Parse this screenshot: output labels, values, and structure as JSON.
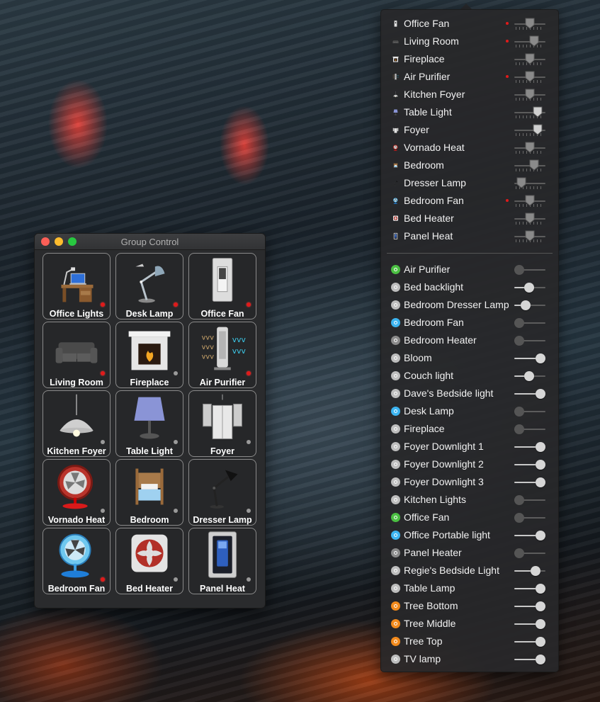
{
  "group_control": {
    "title": "Group Control",
    "tiles": [
      {
        "label": "Office Lights",
        "icon": "desk-icon",
        "led": "on"
      },
      {
        "label": "Desk Lamp",
        "icon": "desk-lamp-icon",
        "led": "on"
      },
      {
        "label": "Office Fan",
        "icon": "light-switch-icon",
        "led": "on"
      },
      {
        "label": "Living Room",
        "icon": "sofa-icon",
        "led": "on"
      },
      {
        "label": "Fireplace",
        "icon": "fireplace-icon",
        "led": "off"
      },
      {
        "label": "Air Purifier",
        "icon": "air-purifier-icon",
        "led": "on"
      },
      {
        "label": "Kitchen Foyer",
        "icon": "pendant-lamp-icon",
        "led": "off"
      },
      {
        "label": "Table Light",
        "icon": "table-lamp-icon",
        "led": "off"
      },
      {
        "label": "Foyer",
        "icon": "doorway-icon",
        "led": "off"
      },
      {
        "label": "Vornado Heat",
        "icon": "red-fan-icon",
        "led": "off"
      },
      {
        "label": "Bedroom",
        "icon": "bed-icon",
        "led": "off"
      },
      {
        "label": "Dresser Lamp",
        "icon": "arc-lamp-icon",
        "led": "off"
      },
      {
        "label": "Bedroom Fan",
        "icon": "blue-fan-icon",
        "led": "on"
      },
      {
        "label": "Bed Heater",
        "icon": "heater-icon",
        "led": "off"
      },
      {
        "label": "Panel Heat",
        "icon": "panel-switch-icon",
        "led": "off"
      }
    ]
  },
  "menu": {
    "group_rows": [
      {
        "label": "Office Fan",
        "icon": "light-switch-icon",
        "active": true,
        "level": 0.5
      },
      {
        "label": "Living Room",
        "icon": "sofa-icon",
        "active": true,
        "level": 0.7
      },
      {
        "label": "Fireplace",
        "icon": "fireplace-icon",
        "active": false,
        "level": 0.5
      },
      {
        "label": "Air Purifier",
        "icon": "air-purifier-icon",
        "active": true,
        "level": 0.5
      },
      {
        "label": "Kitchen Foyer",
        "icon": "pendant-lamp-icon",
        "active": false,
        "level": 0.5
      },
      {
        "label": "Table Light",
        "icon": "table-lamp-icon",
        "active": false,
        "level": 0.85
      },
      {
        "label": "Foyer",
        "icon": "doorway-icon",
        "active": false,
        "level": 0.85
      },
      {
        "label": "Vornado Heat",
        "icon": "red-fan-icon",
        "active": false,
        "level": 0.5
      },
      {
        "label": "Bedroom",
        "icon": "bed-icon",
        "active": false,
        "level": 0.7
      },
      {
        "label": "Dresser Lamp",
        "icon": "arc-lamp-icon",
        "active": false,
        "level": 0.1
      },
      {
        "label": "Bedroom Fan",
        "icon": "blue-fan-icon",
        "active": true,
        "level": 0.5
      },
      {
        "label": "Bed Heater",
        "icon": "heater-icon",
        "active": false,
        "level": 0.5
      },
      {
        "label": "Panel Heat",
        "icon": "panel-switch-icon",
        "active": false,
        "level": 0.5
      }
    ],
    "device_rows": [
      {
        "label": "Air Purifier",
        "badge": "green",
        "level": 0
      },
      {
        "label": "Bed backlight",
        "badge": "white",
        "level": 0.45
      },
      {
        "label": "Bedroom Dresser Lamp",
        "badge": "white",
        "level": 0.3
      },
      {
        "label": "Bedroom Fan",
        "badge": "blue",
        "level": 0
      },
      {
        "label": "Bedroom Heater",
        "badge": "gray",
        "level": 0
      },
      {
        "label": "Bloom",
        "badge": "white",
        "level": 1
      },
      {
        "label": "Couch light",
        "badge": "white",
        "level": 0.45
      },
      {
        "label": "Dave's Bedside light",
        "badge": "white",
        "level": 1
      },
      {
        "label": "Desk Lamp",
        "badge": "blue",
        "level": 0
      },
      {
        "label": "Fireplace",
        "badge": "white",
        "level": 0
      },
      {
        "label": "Foyer Downlight 1",
        "badge": "white",
        "level": 1
      },
      {
        "label": "Foyer Downlight 2",
        "badge": "white",
        "level": 1
      },
      {
        "label": "Foyer Downlight 3",
        "badge": "white",
        "level": 1
      },
      {
        "label": "Kitchen Lights",
        "badge": "white",
        "level": 0
      },
      {
        "label": "Office Fan",
        "badge": "green",
        "level": 0
      },
      {
        "label": "Office Portable light",
        "badge": "blue",
        "level": 1
      },
      {
        "label": "Panel Heater",
        "badge": "gray",
        "level": 0
      },
      {
        "label": "Regie's Bedside Light",
        "badge": "white",
        "level": 0.75
      },
      {
        "label": "Table Lamp",
        "badge": "white",
        "level": 1
      },
      {
        "label": "Tree Bottom",
        "badge": "orange",
        "level": 1
      },
      {
        "label": "Tree Middle",
        "badge": "orange",
        "level": 1
      },
      {
        "label": "Tree Top",
        "badge": "orange",
        "level": 1
      },
      {
        "label": "TV lamp",
        "badge": "white",
        "level": 1
      }
    ]
  },
  "colors": {
    "led_on": "#e01a1a",
    "badge_blue": "#3cb4f0",
    "badge_green": "#4bbf42",
    "badge_orange": "#f28a1c"
  }
}
